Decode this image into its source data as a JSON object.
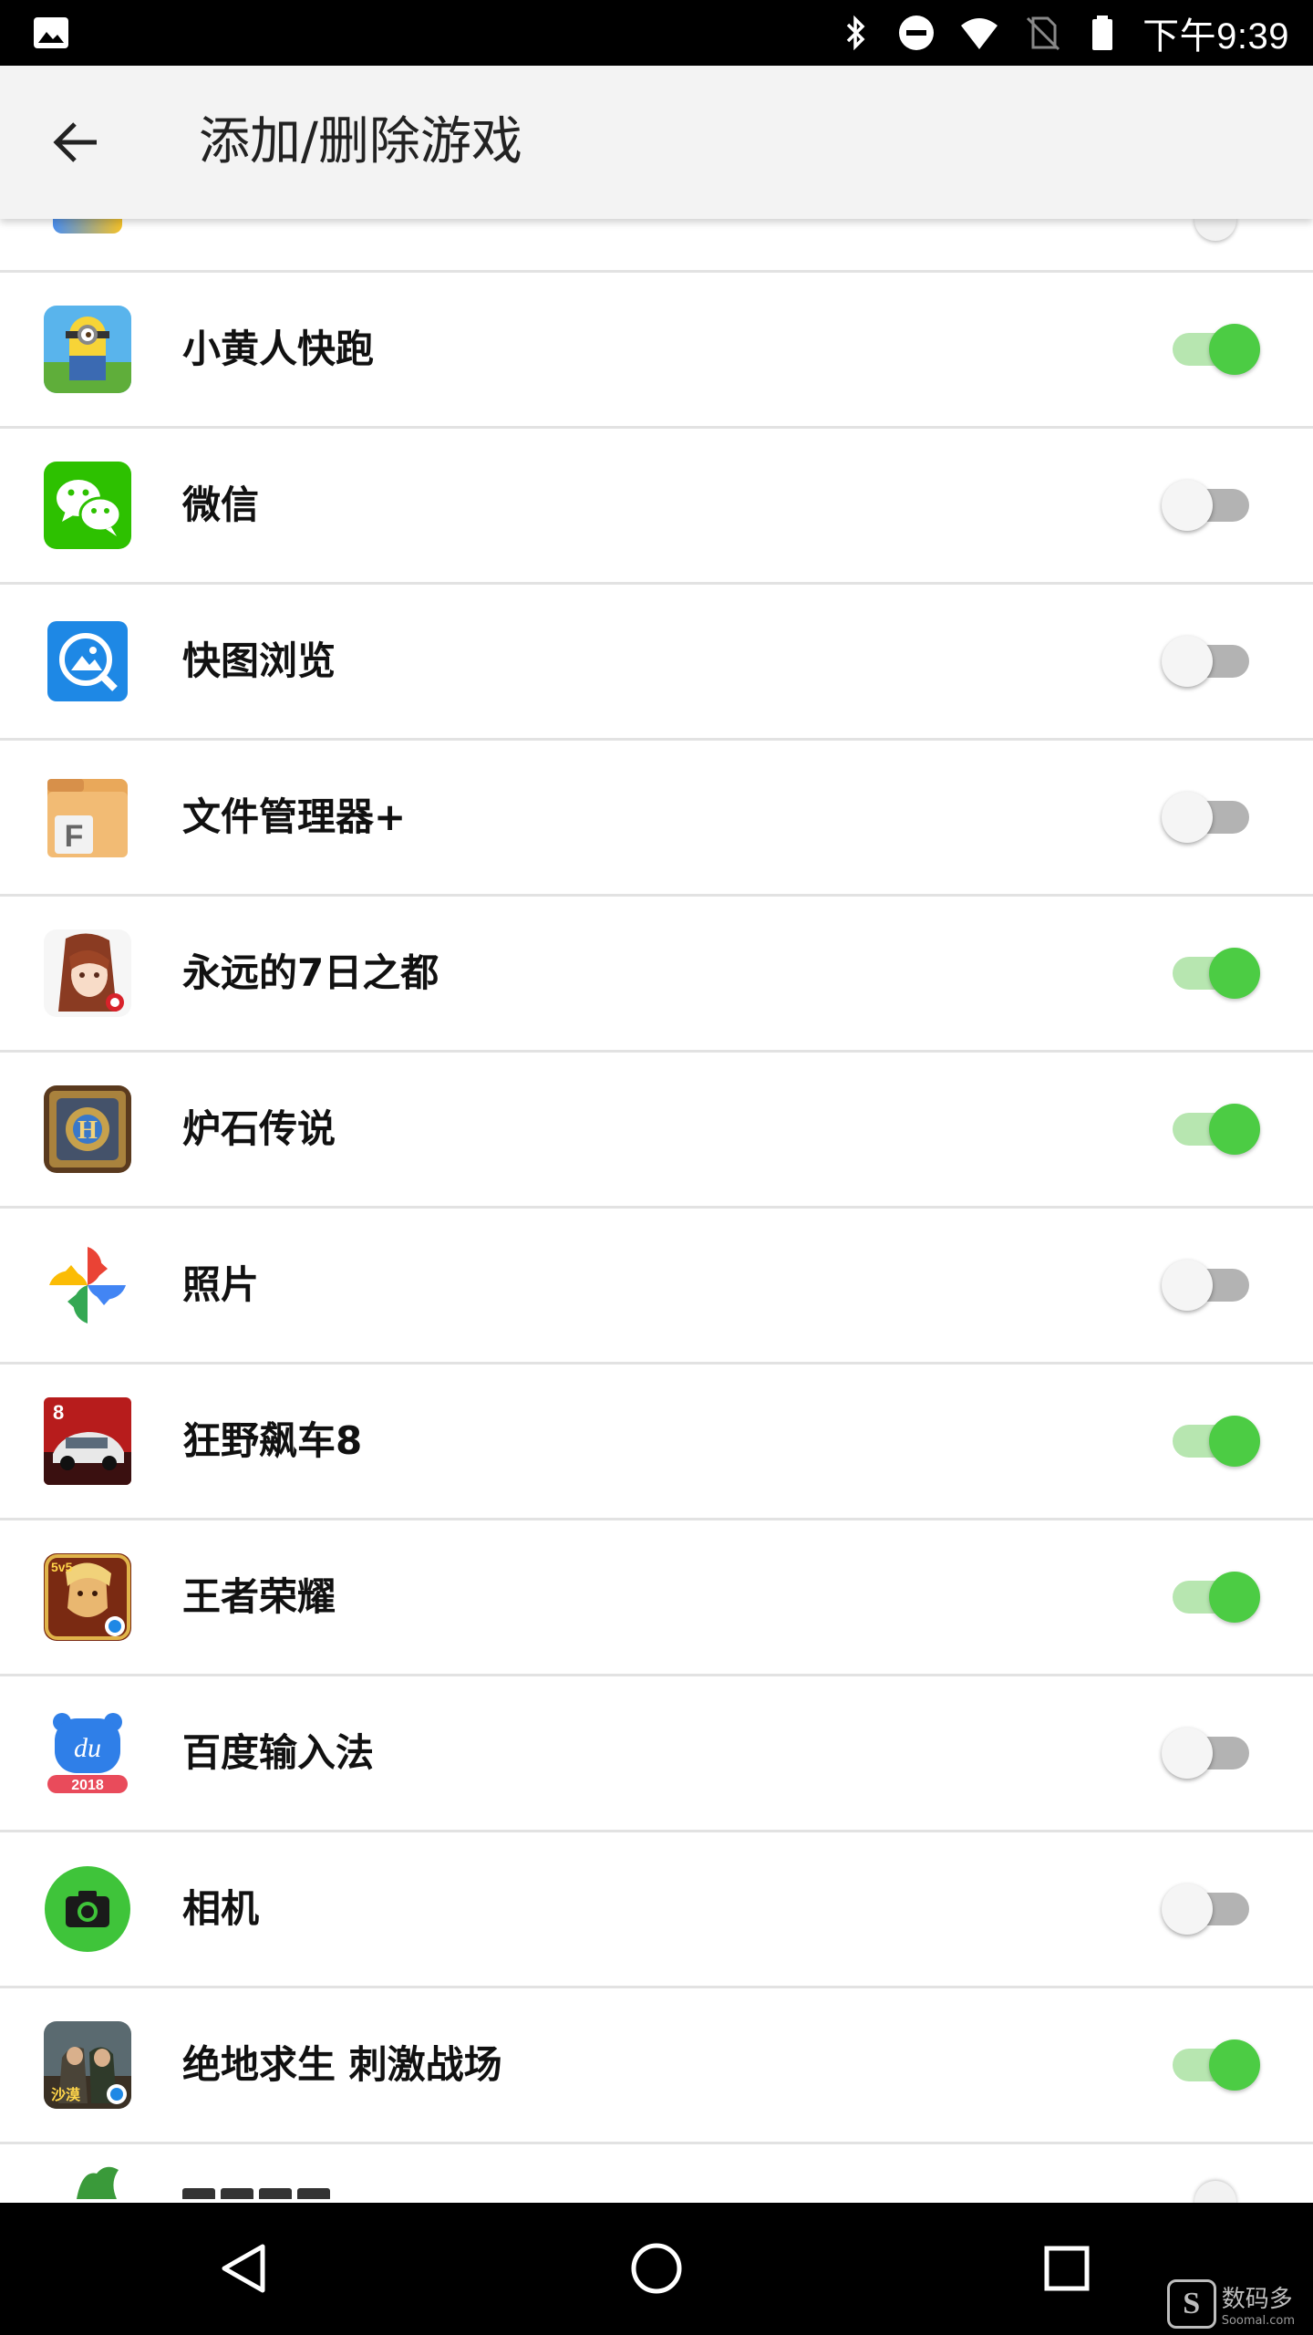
{
  "status_bar": {
    "time": "下午9:39",
    "icons": [
      "image-icon",
      "bluetooth-icon",
      "do-not-disturb-icon",
      "wifi-icon",
      "no-sim-icon",
      "battery-icon"
    ]
  },
  "app_bar": {
    "title": "添加/删除游戏",
    "back_icon": "arrow-back-icon"
  },
  "apps": [
    {
      "name": "小黄人快跑",
      "enabled": true,
      "icon": "minion-rush-icon"
    },
    {
      "name": "微信",
      "enabled": false,
      "icon": "wechat-icon"
    },
    {
      "name": "快图浏览",
      "enabled": false,
      "icon": "quickpic-icon"
    },
    {
      "name": "文件管理器+",
      "enabled": false,
      "icon": "file-manager-icon"
    },
    {
      "name": "永远的7日之都",
      "enabled": true,
      "icon": "eternal-city-icon"
    },
    {
      "name": "炉石传说",
      "enabled": true,
      "icon": "hearthstone-icon"
    },
    {
      "name": "照片",
      "enabled": false,
      "icon": "photos-icon"
    },
    {
      "name": "狂野飙车8",
      "enabled": true,
      "icon": "asphalt8-icon"
    },
    {
      "name": "王者荣耀",
      "enabled": true,
      "icon": "honor-of-kings-icon"
    },
    {
      "name": "百度输入法",
      "enabled": false,
      "icon": "baidu-ime-icon"
    },
    {
      "name": "相机",
      "enabled": false,
      "icon": "camera-icon"
    },
    {
      "name": "绝地求生 刺激战场",
      "enabled": true,
      "icon": "pubg-mobile-icon"
    }
  ],
  "nav_bar": {
    "icons": [
      "back-triangle-icon",
      "home-circle-icon",
      "recents-square-icon"
    ]
  },
  "watermark": {
    "logo": "S",
    "text": "数码多",
    "sub": "Soomal.com"
  },
  "colors": {
    "toggle_on": "#4ccc44",
    "toggle_on_track": "#b7e6b0",
    "toggle_off_thumb": "#f5f5f5",
    "toggle_off_track": "#b3b3b3",
    "app_bar_bg": "#f3f3f3",
    "divider": "#e2e2e2"
  }
}
